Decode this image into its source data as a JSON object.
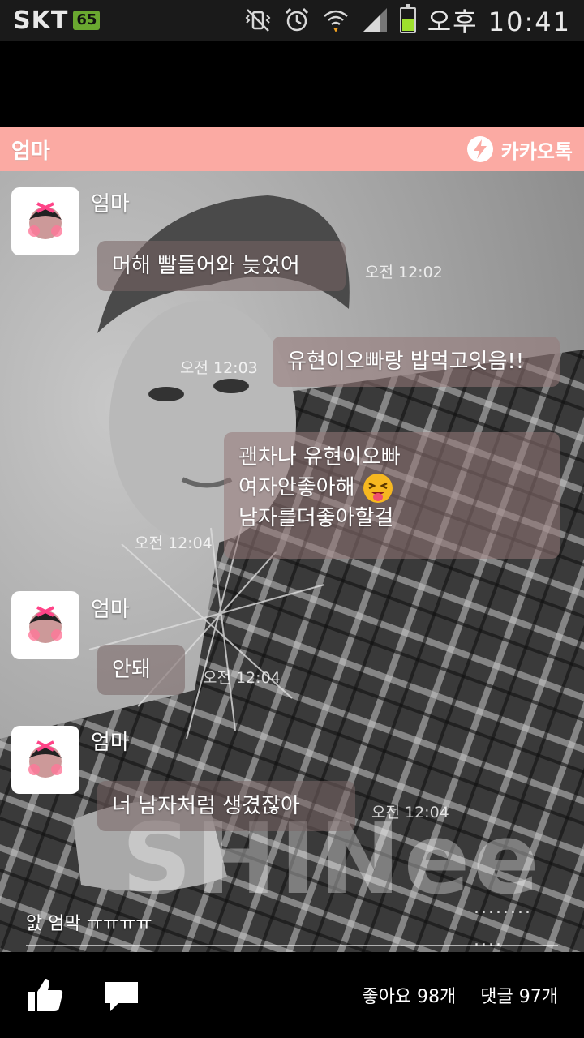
{
  "status_bar": {
    "carrier": "SKT",
    "carrier_badge": "65",
    "time": "오후 10:41",
    "icons": [
      "vibrate-icon",
      "alarm-icon",
      "wifi-icon",
      "signal-icon",
      "battery-icon"
    ]
  },
  "header": {
    "title": "엄마",
    "brand": "카카오톡"
  },
  "messages": [
    {
      "sender": "엄마",
      "text": "머해 빨들어와 늦었어",
      "time": "오전 12:02",
      "side": "left"
    },
    {
      "text": "유현이오빠랑 밥먹고잇음!!",
      "time": "오전 12:03",
      "side": "right"
    },
    {
      "lines": [
        "괜차나 유현이오빠",
        "여자안좋아해",
        "남자를더좋아할걸"
      ],
      "time": "오전 12:04",
      "side": "right"
    },
    {
      "sender": "엄마",
      "text": "안돼",
      "time": "오전 12:04",
      "side": "left"
    },
    {
      "sender": "엄마",
      "text": "너 남자처럼 생겼잖아",
      "time": "오전 12:04",
      "side": "left"
    }
  ],
  "overlay": {
    "art_text": "SHINee",
    "dots_1": "........",
    "dots_2": "....",
    "preview": "앐 엄막 ㅠㅠㅠㅠ"
  },
  "bottom_bar": {
    "likes": "좋아요 98개",
    "comments": "댓글 97개",
    "icons": [
      "thumbs-up-icon",
      "comment-icon"
    ]
  },
  "colors": {
    "header_bg": "#fbaaa3",
    "status_bg": "#1a1a1a"
  }
}
